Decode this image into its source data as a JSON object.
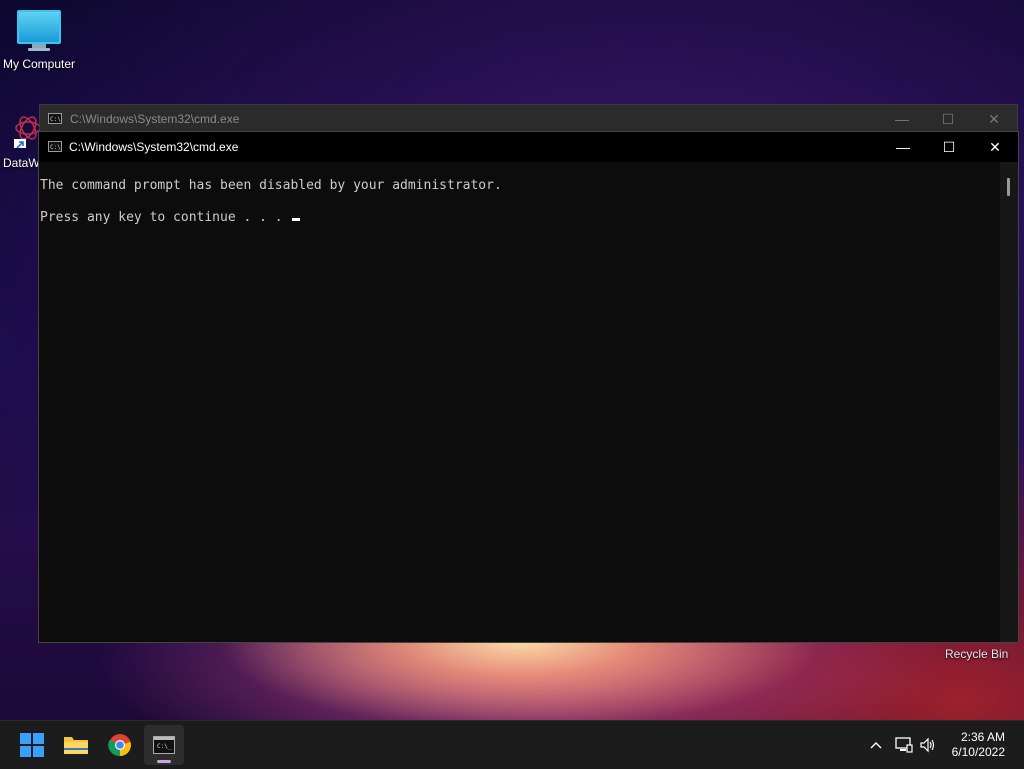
{
  "desktop": {
    "icons": [
      {
        "label": "My Computer"
      },
      {
        "label": "DataW"
      }
    ],
    "recycle_bin_label": "Recycle Bin"
  },
  "cmd_back_window": {
    "title": "C:\\Windows\\System32\\cmd.exe"
  },
  "cmd_window": {
    "title": "C:\\Windows\\System32\\cmd.exe",
    "lines": [
      "The command prompt has been disabled by your administrator.",
      "Press any key to continue . . . "
    ],
    "buttons": {
      "minimize": "—",
      "maximize": "☐",
      "close": "✕"
    }
  },
  "taskbar": {
    "apps": [
      {
        "name": "windows-start",
        "icon": "windows-logo-icon"
      },
      {
        "name": "file-explorer",
        "icon": "folder-icon"
      },
      {
        "name": "chrome",
        "icon": "chrome-icon"
      },
      {
        "name": "command-prompt",
        "icon": "cmd-icon",
        "active": true
      }
    ],
    "tray": {
      "chevron": "^",
      "time": "2:36 AM",
      "date": "6/10/2022"
    }
  },
  "colors": {
    "console_bg": "#0c0c0c",
    "console_text": "#cccccc",
    "taskbar_bg": "#1c1c1c"
  }
}
